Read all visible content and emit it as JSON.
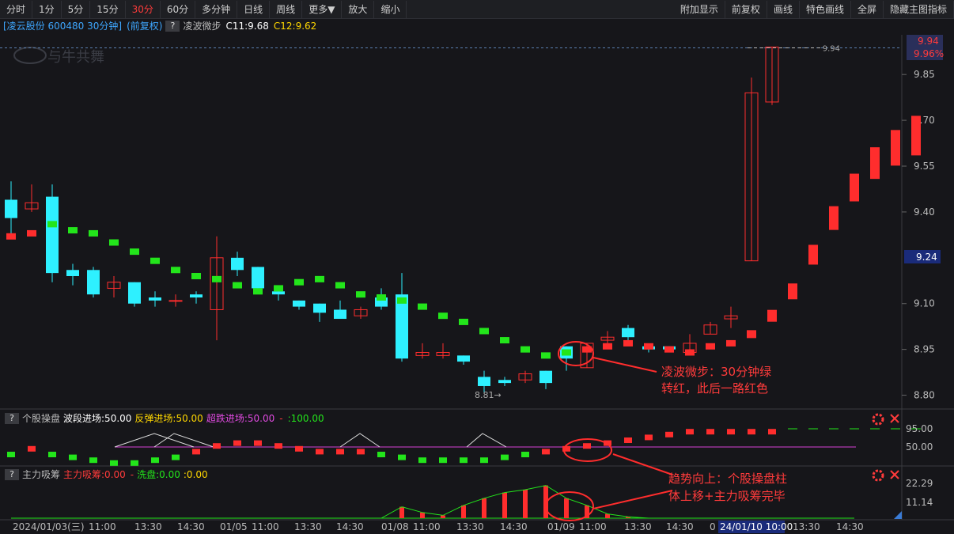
{
  "toolbar": {
    "left": [
      "分时",
      "1分",
      "5分",
      "15分",
      "30分",
      "60分",
      "多分钟",
      "日线",
      "周线",
      "更多▼",
      "放大",
      "缩小"
    ],
    "active": "30分",
    "right": [
      "附加显示",
      "前复权",
      "画线",
      "特色画线",
      "全屏",
      "隐藏主图指标"
    ]
  },
  "info": {
    "stock": "[凌云股份 600480 30分钟]",
    "fq": "(前复权)",
    "help": "?",
    "indicator": "凌波微步",
    "c1": "C11:9.68",
    "c2": "C12:9.62"
  },
  "watermark": "与牛共舞",
  "price_axis": {
    "ticks": [
      "9.94",
      "9.96%",
      "9.85",
      "9.70",
      "9.55",
      "9.40",
      "9.24",
      "9.10",
      "8.95",
      "8.80"
    ],
    "top_price_label": "9.94",
    "current_label": "9.24",
    "line_label": "9.94",
    "low_label": "8.81"
  },
  "annotations": {
    "main_note_1": "凌波微步：30分钟绿",
    "main_note_2": "转红，此后一路红色",
    "sub_note_1": "趋势向上：个股操盘柱",
    "sub_note_2": "体上移+主力吸筹完毕"
  },
  "sub1": {
    "help": "?",
    "name": "个股操盘",
    "l1": "波段进场:50.00",
    "l2": "反弹进场:50.00",
    "l3": "超跌进场:50.00",
    "l4": "-",
    "l5": ":100.00",
    "ticks": [
      "95.00",
      "50.00"
    ]
  },
  "sub2": {
    "help": "?",
    "name": "主力吸筹",
    "l1": "主力吸筹:0.00",
    "l2": "-",
    "l3": "洗盘:0.00",
    "l4": ":0.00",
    "ticks": [
      "22.29",
      "11.14"
    ]
  },
  "time_axis": [
    "2024/01/03(三)",
    "11:00",
    "13:30",
    "14:30",
    "01/05",
    "11:00",
    "13:30",
    "14:30",
    "01/08",
    "11:00",
    "13:30",
    "14:30",
    "01/09",
    "11:00",
    "13:30",
    "14:30",
    "0",
    "24/01/10 10:00",
    "13:30",
    "14:30"
  ],
  "colors": {
    "up": "#ff2d2d",
    "down": "#2ef0ff",
    "green": "#23e51b",
    "magenta": "#d640d6",
    "bg": "#16161a"
  },
  "chart_data": {
    "type": "candlestick",
    "ylim": [
      8.76,
      9.98
    ],
    "candles": [
      [
        9.44,
        9.38,
        9.5,
        9.32
      ],
      [
        9.41,
        9.43,
        9.49,
        9.4
      ],
      [
        9.45,
        9.2,
        9.49,
        9.17
      ],
      [
        9.21,
        9.19,
        9.23,
        9.16
      ],
      [
        9.21,
        9.13,
        9.22,
        9.12
      ],
      [
        9.15,
        9.17,
        9.19,
        9.12
      ],
      [
        9.17,
        9.1,
        9.17,
        9.09
      ],
      [
        9.12,
        9.11,
        9.14,
        9.09
      ],
      [
        9.11,
        9.11,
        9.13,
        9.09
      ],
      [
        9.13,
        9.12,
        9.14,
        9.1
      ],
      [
        9.08,
        9.25,
        9.32,
        8.98
      ],
      [
        9.25,
        9.21,
        9.27,
        9.19
      ],
      [
        9.22,
        9.15,
        9.22,
        9.14
      ],
      [
        9.14,
        9.13,
        9.16,
        9.11
      ],
      [
        9.11,
        9.09,
        9.11,
        9.08
      ],
      [
        9.1,
        9.07,
        9.1,
        9.04
      ],
      [
        9.08,
        9.05,
        9.11,
        9.05
      ],
      [
        9.06,
        9.08,
        9.09,
        9.05
      ],
      [
        9.12,
        9.09,
        9.15,
        9.08
      ],
      [
        9.13,
        8.92,
        9.2,
        8.91
      ],
      [
        8.93,
        8.94,
        8.97,
        8.92
      ],
      [
        8.93,
        8.94,
        8.97,
        8.92
      ],
      [
        8.93,
        8.91,
        8.93,
        8.9
      ],
      [
        8.86,
        8.83,
        8.88,
        8.81
      ],
      [
        8.85,
        8.84,
        8.86,
        8.83
      ],
      [
        8.85,
        8.87,
        8.88,
        8.84
      ],
      [
        8.88,
        8.84,
        8.88,
        8.82
      ],
      [
        8.96,
        8.92,
        8.96,
        8.88
      ],
      [
        8.89,
        8.97,
        8.97,
        8.89
      ],
      [
        8.98,
        8.99,
        9.01,
        8.96
      ],
      [
        9.02,
        8.99,
        9.03,
        8.97
      ],
      [
        8.96,
        8.95,
        8.96,
        8.94
      ],
      [
        8.96,
        8.95,
        8.96,
        8.95
      ],
      [
        8.94,
        8.97,
        9.0,
        8.93
      ],
      [
        9.0,
        9.03,
        9.04,
        9.0
      ],
      [
        9.05,
        9.06,
        9.09,
        9.02
      ],
      [
        9.24,
        9.79,
        9.84,
        9.24
      ],
      [
        9.76,
        9.94,
        9.94,
        9.75
      ]
    ],
    "step_up": [
      [
        4,
        9.31,
        9.33
      ],
      [
        5,
        9.31,
        9.33
      ]
    ],
    "sub1_bars": [
      0,
      2,
      0,
      -1,
      -2,
      -3,
      -3,
      -2,
      -1,
      1,
      3,
      4,
      4,
      3,
      2,
      1,
      1,
      1,
      0,
      -1,
      -2,
      -2,
      -2,
      -2,
      -1,
      0,
      1,
      2,
      3,
      4,
      5,
      6,
      7,
      8,
      8,
      8,
      8,
      8
    ],
    "sub2_values": [
      0,
      0,
      0,
      0,
      0,
      0,
      0,
      0,
      0,
      0,
      0,
      0,
      0,
      0,
      0,
      0,
      0,
      0,
      0,
      8,
      4,
      2,
      9,
      14,
      18,
      20,
      23,
      14,
      9,
      3,
      1,
      0,
      0,
      0,
      0,
      0,
      0,
      0
    ]
  }
}
